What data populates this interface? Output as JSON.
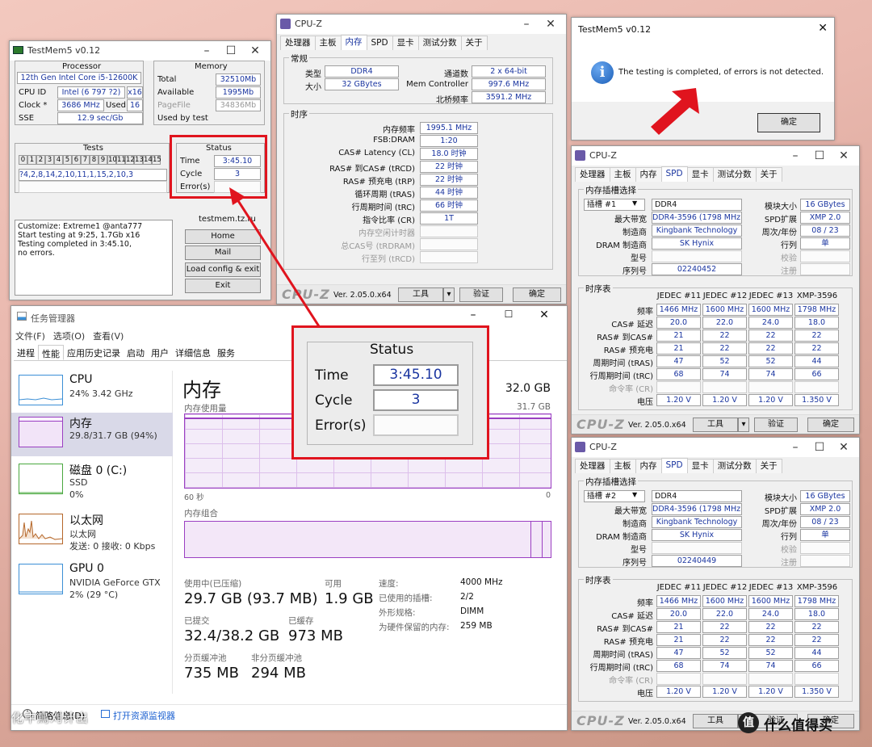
{
  "tm_main": {
    "title": "TestMem5 v0.12",
    "processor_label": "Processor",
    "cpu_name": "12th Gen Intel Core i5-12600K",
    "cpu_id_label": "CPU ID",
    "cpu_id": "Intel (6 797 ?2)",
    "cpu_id_x": "x16",
    "clock_label": "Clock *",
    "clock": "3686 MHz",
    "used_label": "Used",
    "used": "16",
    "sse_label": "SSE",
    "sse": "12.9 sec/Gb",
    "memory_label": "Memory",
    "total_label": "Total",
    "total": "32510Mb",
    "available_label": "Available",
    "available": "1995Mb",
    "pagefile_label": "PageFile",
    "pagefile": "34836Mb",
    "used_by_test_label": "Used by test",
    "tests_label": "Tests",
    "test_numbers": [
      "0",
      "1",
      "2",
      "3",
      "4",
      "5",
      "6",
      "7",
      "8",
      "9",
      "10",
      "11",
      "12",
      "13",
      "14",
      "15"
    ],
    "test_sequence": "?4,2,8,14,2,10,11,1,15,2,10,3",
    "status_label": "Status",
    "time_label": "Time",
    "time": "3:45.10",
    "cycle_label": "Cycle",
    "cycle": "3",
    "errors_label": "Error(s)",
    "log_lines": [
      "Customize: Extreme1 @anta777",
      "Start testing at 9:25, 1.7Gb x16",
      "Testing completed in 3:45.10,",
      "no errors."
    ],
    "site": "testmem.tz.ru",
    "btn_home": "Home",
    "btn_mail": "Mail",
    "btn_load": "Load config & exit",
    "btn_exit": "Exit"
  },
  "tm_msg": {
    "title": "TestMem5 v0.12",
    "message": "The testing is completed, of errors is not detected.",
    "ok": "确定"
  },
  "zoom": {
    "status_label": "Status",
    "time_label": "Time",
    "time": "3:45.10",
    "cycle_label": "Cycle",
    "cycle": "3",
    "errors_label": "Error(s)"
  },
  "cpuz_mem": {
    "title": "CPU-Z",
    "tabs": [
      "处理器",
      "主板",
      "内存",
      "SPD",
      "显卡",
      "测试分数",
      "关于"
    ],
    "active_tab": "内存",
    "general_label": "常规",
    "type_label": "类型",
    "type": "DDR4",
    "channels_label": "通道数",
    "channels": "2 x 64-bit",
    "size_label": "大小",
    "size": "32 GBytes",
    "memctrl_label": "Mem Controller",
    "memctrl": "997.6 MHz",
    "nb_label": "北桥频率",
    "nb": "3591.2 MHz",
    "timings_label": "时序",
    "rows": [
      {
        "label": "内存频率",
        "value": "1995.1 MHz"
      },
      {
        "label": "FSB:DRAM",
        "value": "1:20"
      },
      {
        "label": "CAS# Latency (CL)",
        "value": "18.0 时钟"
      },
      {
        "label": "RAS# 到CAS# (tRCD)",
        "value": "22 时钟"
      },
      {
        "label": "RAS# 预充电 (tRP)",
        "value": "22 时钟"
      },
      {
        "label": "循环周期 (tRAS)",
        "value": "44 时钟"
      },
      {
        "label": "行周期时间 (tRC)",
        "value": "66 时钟"
      },
      {
        "label": "指令比率 (CR)",
        "value": "1T"
      },
      {
        "label": "内存空闲计时器",
        "value": ""
      },
      {
        "label": "总CAS号 (tRDRAM)",
        "value": ""
      },
      {
        "label": "行至列 (tRCD)",
        "value": ""
      }
    ],
    "logo": "CPU-Z",
    "version": "Ver. 2.05.0.x64",
    "tools": "工具",
    "validate": "验证",
    "ok": "确定"
  },
  "cpuz_spd": [
    {
      "title": "CPU-Z",
      "tabs": [
        "处理器",
        "主板",
        "内存",
        "SPD",
        "显卡",
        "测试分数",
        "关于"
      ],
      "active_tab": "SPD",
      "slot_group": "内存插槽选择",
      "slot": "插槽 #1",
      "type": "DDR4",
      "module_size_label": "模块大小",
      "module_size": "16 GBytes",
      "max_bw_label": "最大带宽",
      "max_bw": "DDR4-3596 (1798 MHz)",
      "spd_ext_label": "SPD扩展",
      "spd_ext": "XMP 2.0",
      "mfr_label": "制造商",
      "mfr": "Kingbank Technology",
      "week_label": "周次/年份",
      "week": "08 / 23",
      "dram_mfr_label": "DRAM 制造商",
      "dram_mfr": "SK Hynix",
      "rank_label": "行列",
      "rank": "单",
      "part_label": "型号",
      "check_label": "校验",
      "serial_label": "序列号",
      "serial": "02240452",
      "reg_label": "注册",
      "timing_table": "时序表",
      "cols": [
        "JEDEC #11",
        "JEDEC #12",
        "JEDEC #13",
        "XMP-3596"
      ],
      "rows": [
        {
          "label": "频率",
          "vals": [
            "1466 MHz",
            "1600 MHz",
            "1600 MHz",
            "1798 MHz"
          ]
        },
        {
          "label": "CAS# 延迟",
          "vals": [
            "20.0",
            "22.0",
            "24.0",
            "18.0"
          ]
        },
        {
          "label": "RAS# 到CAS#",
          "vals": [
            "21",
            "22",
            "22",
            "22"
          ]
        },
        {
          "label": "RAS# 预充电",
          "vals": [
            "21",
            "22",
            "22",
            "22"
          ]
        },
        {
          "label": "周期时间 (tRAS)",
          "vals": [
            "47",
            "52",
            "52",
            "44"
          ]
        },
        {
          "label": "行周期时间 (tRC)",
          "vals": [
            "68",
            "74",
            "74",
            "66"
          ]
        },
        {
          "label": "命令率 (CR)",
          "vals": [
            "",
            "",
            "",
            ""
          ]
        },
        {
          "label": "电压",
          "vals": [
            "1.20 V",
            "1.20 V",
            "1.20 V",
            "1.350 V"
          ]
        }
      ],
      "logo": "CPU-Z",
      "version": "Ver. 2.05.0.x64",
      "tools": "工具",
      "validate": "验证",
      "ok": "确定"
    },
    {
      "title": "CPU-Z",
      "tabs": [
        "处理器",
        "主板",
        "内存",
        "SPD",
        "显卡",
        "测试分数",
        "关于"
      ],
      "active_tab": "SPD",
      "slot_group": "内存插槽选择",
      "slot": "插槽 #2",
      "type": "DDR4",
      "module_size_label": "模块大小",
      "module_size": "16 GBytes",
      "max_bw_label": "最大带宽",
      "max_bw": "DDR4-3596 (1798 MHz)",
      "spd_ext_label": "SPD扩展",
      "spd_ext": "XMP 2.0",
      "mfr_label": "制造商",
      "mfr": "Kingbank Technology",
      "week_label": "周次/年份",
      "week": "08 / 23",
      "dram_mfr_label": "DRAM 制造商",
      "dram_mfr": "SK Hynix",
      "rank_label": "行列",
      "rank": "单",
      "part_label": "型号",
      "check_label": "校验",
      "serial_label": "序列号",
      "serial": "02240449",
      "reg_label": "注册",
      "timing_table": "时序表",
      "cols": [
        "JEDEC #11",
        "JEDEC #12",
        "JEDEC #13",
        "XMP-3596"
      ],
      "rows": [
        {
          "label": "频率",
          "vals": [
            "1466 MHz",
            "1600 MHz",
            "1600 MHz",
            "1798 MHz"
          ]
        },
        {
          "label": "CAS# 延迟",
          "vals": [
            "20.0",
            "22.0",
            "24.0",
            "18.0"
          ]
        },
        {
          "label": "RAS# 到CAS#",
          "vals": [
            "21",
            "22",
            "22",
            "22"
          ]
        },
        {
          "label": "RAS# 预充电",
          "vals": [
            "21",
            "22",
            "22",
            "22"
          ]
        },
        {
          "label": "周期时间 (tRAS)",
          "vals": [
            "47",
            "52",
            "52",
            "44"
          ]
        },
        {
          "label": "行周期时间 (tRC)",
          "vals": [
            "68",
            "74",
            "74",
            "66"
          ]
        },
        {
          "label": "命令率 (CR)",
          "vals": [
            "",
            "",
            "",
            ""
          ]
        },
        {
          "label": "电压",
          "vals": [
            "1.20 V",
            "1.20 V",
            "1.20 V",
            "1.350 V"
          ]
        }
      ],
      "logo": "CPU-Z",
      "version": "Ver. 2.05.0.x64",
      "tools": "工具",
      "validate": "验证",
      "ok": "确定"
    }
  ],
  "taskmgr": {
    "title": "任务管理器",
    "menu": [
      "文件(F)",
      "选项(O)",
      "查看(V)"
    ],
    "tabs": [
      "进程",
      "性能",
      "应用历史记录",
      "启动",
      "用户",
      "详细信息",
      "服务"
    ],
    "active_tab": "性能",
    "side": [
      {
        "name": "CPU",
        "sub1": "24% 3.42 GHz",
        "sub2": ""
      },
      {
        "name": "内存",
        "sub1": "29.8/31.7 GB (94%)",
        "sub2": ""
      },
      {
        "name": "磁盘 0 (C:)",
        "sub1": "SSD",
        "sub2": "0%"
      },
      {
        "name": "以太网",
        "sub1": "以太网",
        "sub2": "发送: 0 接收: 0 Kbps"
      },
      {
        "name": "GPU 0",
        "sub1": "NVIDIA GeForce GTX",
        "sub2": "2% (29 °C)"
      }
    ],
    "heading": "内存",
    "capacity": "32.0 GB",
    "usage_label": "内存使用量",
    "usage_max": "31.7 GB",
    "sec_label": "60 秒",
    "zero_label": "0",
    "composition_label": "内存组合",
    "in_use_label": "使用中(已压缩)",
    "in_use": "29.7 GB (93.7 MB)",
    "avail_label": "可用",
    "avail": "1.9 GB",
    "committed_label": "已提交",
    "committed": "32.4/38.2 GB",
    "cached_label": "已缓存",
    "cached": "973 MB",
    "paged_label": "分页缓冲池",
    "paged": "735 MB",
    "nonpaged_label": "非分页缓冲池",
    "nonpaged": "294 MB",
    "speed_label": "速度:",
    "speed": "4000 MHz",
    "slots_label": "已使用的插槽:",
    "slots": "2/2",
    "form_label": "外形规格:",
    "form": "DIMM",
    "hw_label": "为硬件保留的内存:",
    "hw": "259 MB",
    "summary": "简略信息(D)",
    "open_monitor": "打开资源监视器"
  },
  "watermarks": {
    "left": "化中鳥刈计出",
    "right": "值 什么值得买"
  },
  "colors": {
    "accent_red": "#e0141e",
    "cpuz_value": "#1a35a0",
    "tm_memory": "#9b3fc2"
  }
}
